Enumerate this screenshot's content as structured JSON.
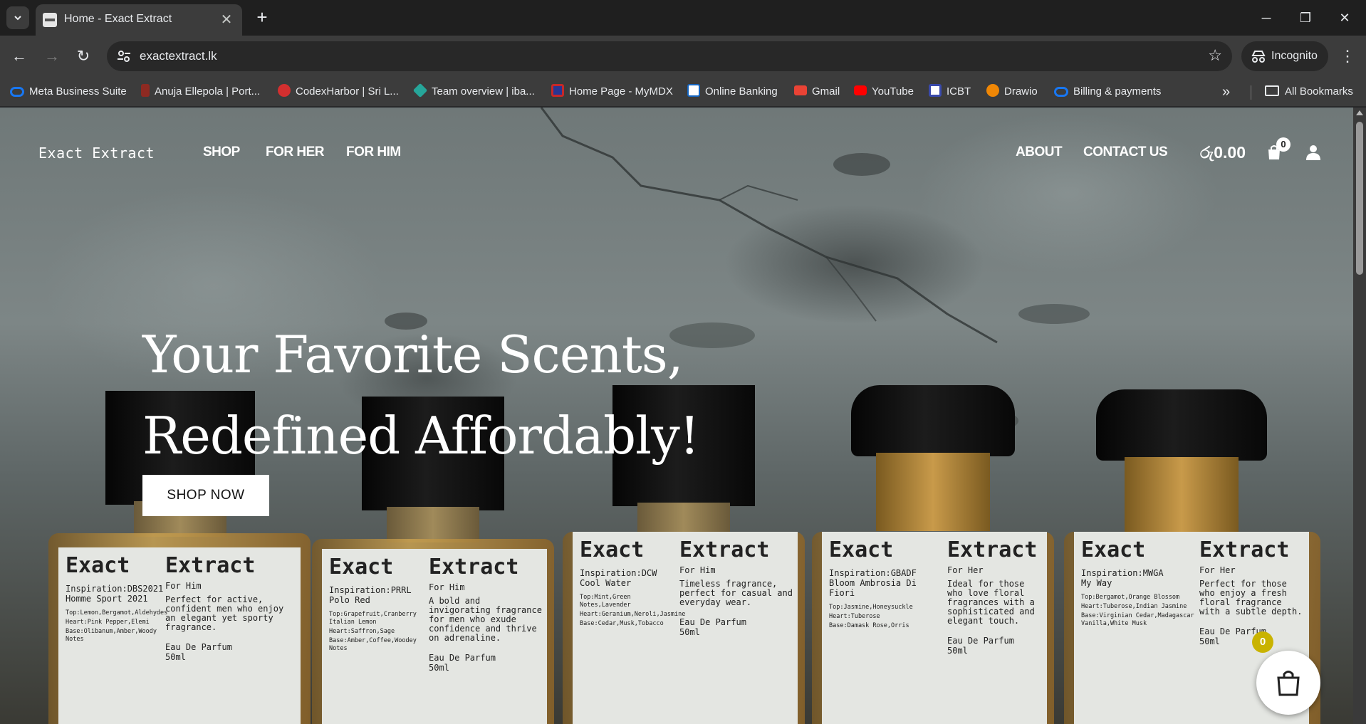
{
  "browser": {
    "tab_title": "Home - Exact Extract",
    "url": "exactextract.lk",
    "profile_label": "Incognito",
    "bookmarks": [
      {
        "label": "Meta Business Suite",
        "icon": "meta-icon",
        "color": "#1877f2"
      },
      {
        "label": "Anuja Ellepola | Port...",
        "icon": "portfolio-icon",
        "color": "#c0392b"
      },
      {
        "label": "CodexHarbor | Sri L...",
        "icon": "codexharbor-icon",
        "color": "#d32f2f"
      },
      {
        "label": "Team overview | iba...",
        "icon": "diamond-icon",
        "color": "#26a69a"
      },
      {
        "label": "Home Page - MyMDX",
        "icon": "mymdx-icon",
        "color": "#c62828"
      },
      {
        "label": "Online Banking",
        "icon": "bank-icon",
        "color": "#1565c0"
      },
      {
        "label": "Gmail",
        "icon": "gmail-icon",
        "color": "#ea4335"
      },
      {
        "label": "YouTube",
        "icon": "youtube-icon",
        "color": "#ff0000"
      },
      {
        "label": "ICBT",
        "icon": "icbt-icon",
        "color": "#3949ab"
      },
      {
        "label": "Drawio",
        "icon": "drawio-icon",
        "color": "#f08705"
      },
      {
        "label": "Billing & payments",
        "icon": "meta-icon",
        "color": "#1877f2"
      }
    ],
    "all_bookmarks": "All Bookmarks"
  },
  "site": {
    "brand": "Exact Extract",
    "nav": {
      "shop": "SHOP",
      "for_her": "FOR HER",
      "for_him": "FOR HIM",
      "about": "ABOUT",
      "contact": "CONTACT US"
    },
    "cart_total": "රු0.00",
    "cart_count": "0",
    "hero_line1": "Your Favorite Scents,",
    "hero_line2": "Redefined Affordably!",
    "cta": "SHOP NOW",
    "floating_cart_count": "0"
  },
  "bottles": [
    {
      "brand_left": "Exact",
      "brand_right": "Extract",
      "inspiration": "Inspiration:DBS2021",
      "name": "Homme Sport 2021",
      "notes_top": "Top:Lemon,Bergamot,Aldehydes",
      "notes_heart": "Heart:Pink Pepper,Elemi",
      "notes_base": "Base:Olibanum,Amber,Woody Notes",
      "for": "For Him",
      "desc": "Perfect for active, confident men who enjoy an elegant yet sporty fragrance.",
      "edp": "Eau De Parfum",
      "size": "50ml"
    },
    {
      "brand_left": "Exact",
      "brand_right": "Extract",
      "inspiration": "Inspiration:PRRL",
      "name": "Polo Red",
      "notes_top": "Top:Grapefruit,Cranberry Italian Lemon",
      "notes_heart": "Heart:Saffron,Sage",
      "notes_base": "Base:Amber,Coffee,Woodey Notes",
      "for": "For Him",
      "desc": "A bold and invigorating fragrance for men who exude confidence and thrive on adrenaline.",
      "edp": "Eau De Parfum",
      "size": "50ml"
    },
    {
      "brand_left": "Exact",
      "brand_right": "Extract",
      "inspiration": "Inspiration:DCW",
      "name": "Cool Water",
      "notes_top": "Top:Mint,Green Notes,Lavender",
      "notes_heart": "Heart:Geranium,Neroli,Jasmine",
      "notes_base": "Base:Cedar,Musk,Tobacco",
      "for": "For Him",
      "desc": "Timeless fragrance, perfect for casual and everyday wear.",
      "edp": "Eau De Parfum",
      "size": "50ml"
    },
    {
      "brand_left": "Exact",
      "brand_right": "Extract",
      "inspiration": "Inspiration:GBADF",
      "name": "Bloom Ambrosia Di Fiori",
      "notes_top": "Top:Jasmine,Honeysuckle",
      "notes_heart": "Heart:Tuberose",
      "notes_base": "Base:Damask Rose,Orris",
      "for": "For Her",
      "desc": "Ideal for those who love floral fragrances with a sophisticated and elegant touch.",
      "edp": "Eau De Parfum",
      "size": "50ml"
    },
    {
      "brand_left": "Exact",
      "brand_right": "Extract",
      "inspiration": "Inspiration:MWGA",
      "name": "My Way",
      "notes_top": "Top:Bergamot,Orange Blossom",
      "notes_heart": "Heart:Tuberose,Indian Jasmine",
      "notes_base": "Base:Virginian Cedar,Madagascar Vanilla,White Musk",
      "for": "For Her",
      "desc": "Perfect for those who enjoy a fresh floral fragrance with a subtle depth.",
      "edp": "Eau De Parfum",
      "size": "50ml"
    }
  ]
}
